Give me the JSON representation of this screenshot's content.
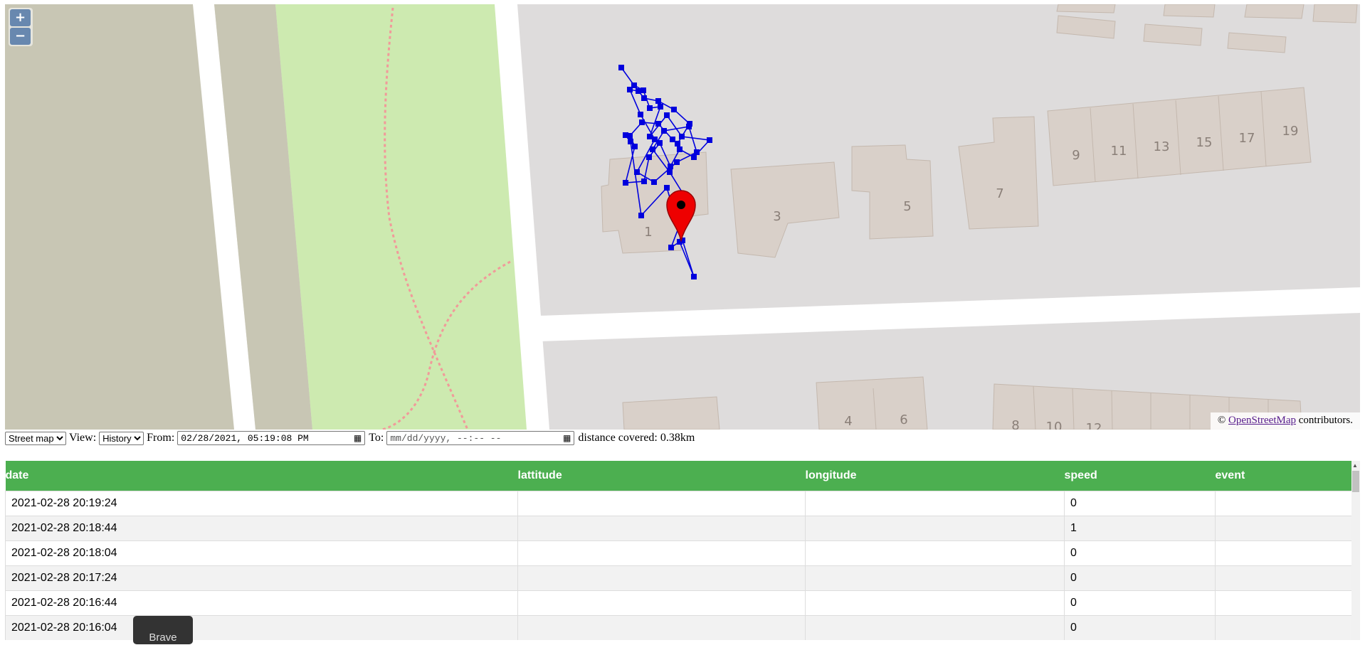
{
  "map": {
    "zoom_in": "+",
    "zoom_out": "−",
    "attribution_prefix": "© ",
    "attribution_link": "OpenStreetMap",
    "attribution_suffix": " contributors.",
    "house_numbers": [
      "1",
      "3",
      "5",
      "7",
      "9",
      "11",
      "13",
      "15",
      "17",
      "19",
      "4",
      "6",
      "8",
      "10",
      "12"
    ],
    "track_color": "#0000dd",
    "marker_color": "#ee0000",
    "park_color": "#cdeab0",
    "building_color": "#d9d0c9"
  },
  "controls": {
    "layer_select": "Street map",
    "view_label": "View:",
    "view_select": "History",
    "from_label": "From:",
    "from_value": "02/28/2021, 05:19:08 PM",
    "to_label": "To:",
    "to_placeholder": "mm/dd/yyyy, --:-- --",
    "distance_text": "distance covered: 0.38km"
  },
  "table": {
    "headers": [
      "date",
      "lattitude",
      "longitude",
      "speed",
      "event"
    ],
    "rows": [
      {
        "date": "2021-02-28 20:19:24",
        "lat": "",
        "lon": "",
        "speed": "0",
        "event": ""
      },
      {
        "date": "2021-02-28 20:18:44",
        "lat": "",
        "lon": "",
        "speed": "1",
        "event": ""
      },
      {
        "date": "2021-02-28 20:18:04",
        "lat": "",
        "lon": "",
        "speed": "0",
        "event": ""
      },
      {
        "date": "2021-02-28 20:17:24",
        "lat": "",
        "lon": "",
        "speed": "0",
        "event": ""
      },
      {
        "date": "2021-02-28 20:16:44",
        "lat": "",
        "lon": "",
        "speed": "0",
        "event": ""
      },
      {
        "date": "2021-02-28 20:16:04",
        "lat": "",
        "lon": "",
        "speed": "0",
        "event": ""
      }
    ]
  },
  "tooltip": "Brave"
}
